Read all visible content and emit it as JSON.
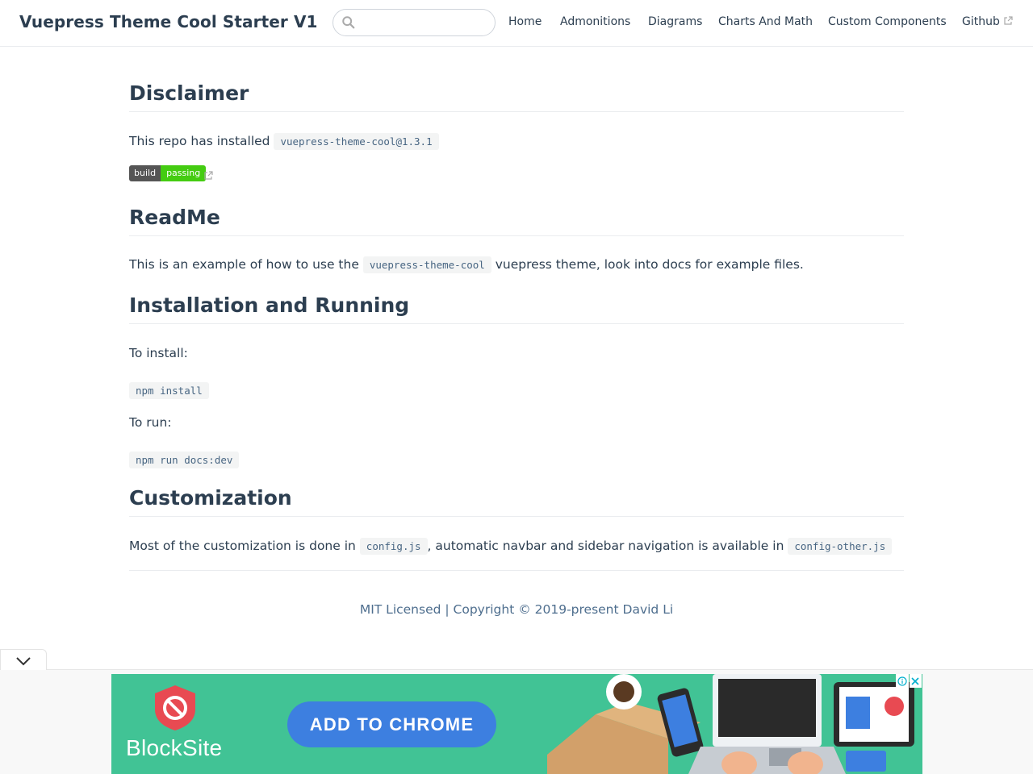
{
  "navbar": {
    "site_title": "Vuepress Theme Cool Starter V1",
    "search": {
      "placeholder": "",
      "value": ""
    },
    "links": [
      {
        "label": "Home"
      },
      {
        "label": "Admonitions"
      },
      {
        "label": "Diagrams"
      },
      {
        "label": "Charts And Math"
      },
      {
        "label": "Custom Components"
      },
      {
        "label": "Github",
        "external": true
      }
    ]
  },
  "sections": {
    "disclaimer": {
      "heading": "Disclaimer",
      "text": "This repo has installed",
      "code": "vuepress-theme-cool@1.3.1",
      "badge": {
        "left": "build",
        "right": "passing"
      }
    },
    "readme": {
      "heading": "ReadMe",
      "text_before": "This is an example of how to use the",
      "code": "vuepress-theme-cool",
      "text_after": "vuepress theme, look into docs for example files."
    },
    "installation": {
      "heading": "Installation and Running",
      "install_label": "To install:",
      "install_cmd": "npm install",
      "run_label": "To run:",
      "run_cmd": "npm run docs:dev"
    },
    "customization": {
      "heading": "Customization",
      "text_before": "Most of the customization is done in",
      "code1": "config.js",
      "text_middle": ", automatic navbar and sidebar navigation is available in",
      "code2": "config-other.js"
    }
  },
  "footer": {
    "text": "MIT Licensed | Copyright © 2019-present David Li"
  },
  "ad": {
    "brand": "BlockSite",
    "cta": "ADD TO CHROME",
    "bg_color": "#41c395",
    "cta_color": "#3d7fe0"
  },
  "colors": {
    "text": "#2c3e50",
    "code_text": "#476582",
    "footer": "#4e6e8e",
    "badge_green": "#4c1"
  }
}
